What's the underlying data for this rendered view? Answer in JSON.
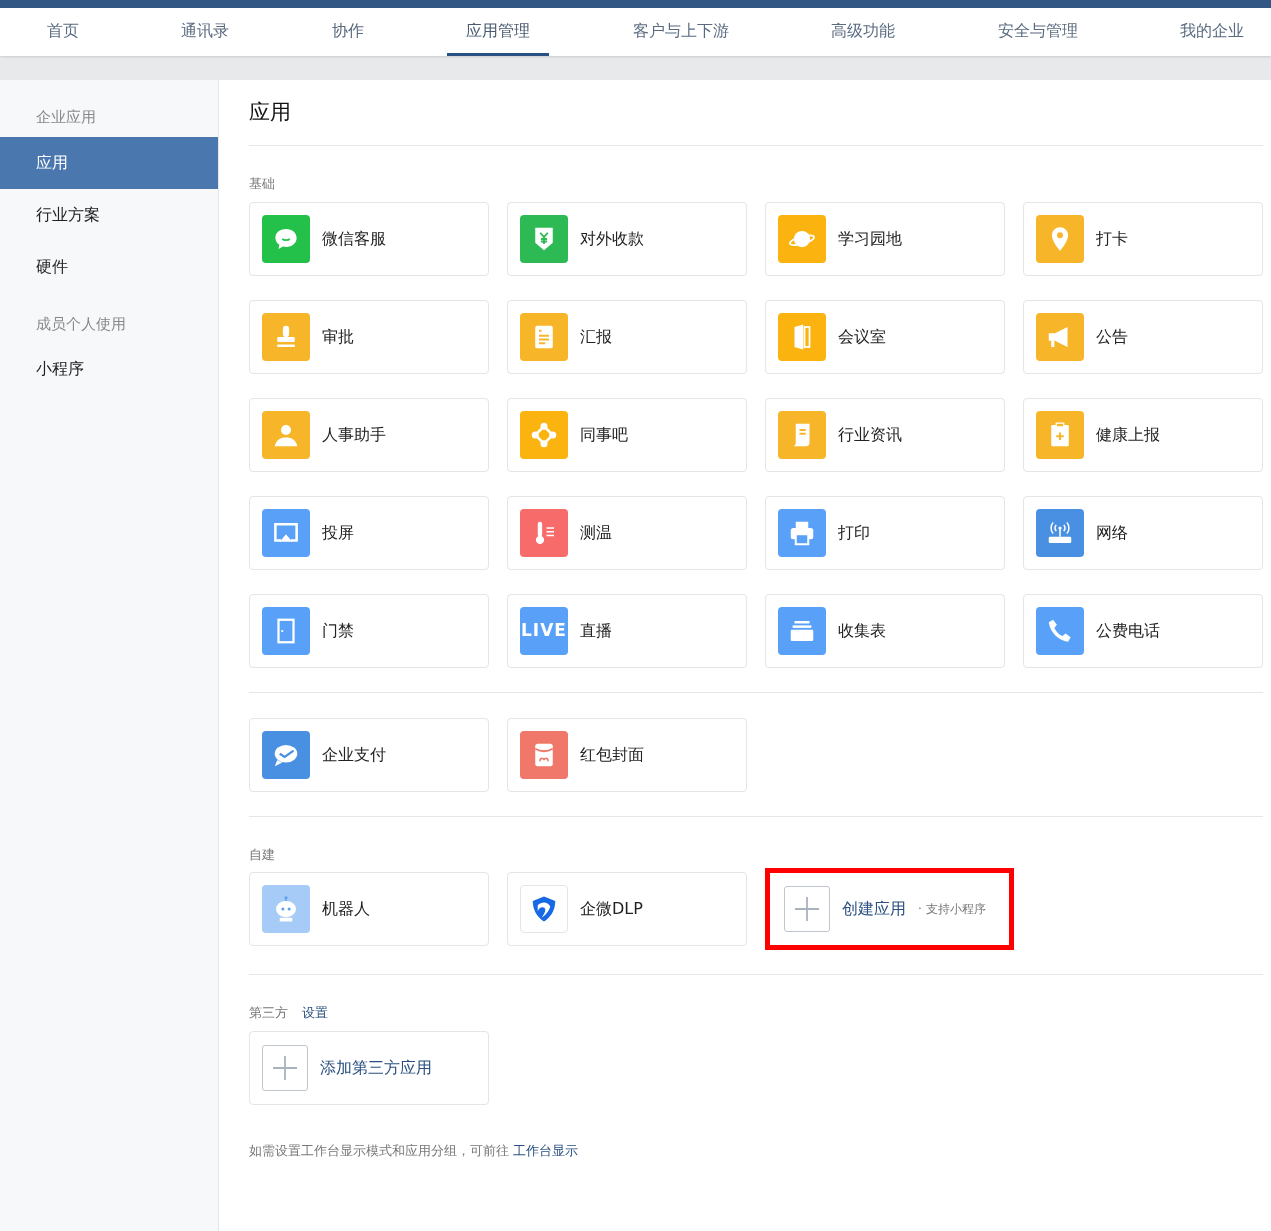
{
  "top_nav": [
    {
      "label": "首页",
      "selected": false
    },
    {
      "label": "通讯录",
      "selected": false
    },
    {
      "label": "协作",
      "selected": false
    },
    {
      "label": "应用管理",
      "selected": true
    },
    {
      "label": "客户与上下游",
      "selected": false
    },
    {
      "label": "高级功能",
      "selected": false
    },
    {
      "label": "安全与管理",
      "selected": false
    },
    {
      "label": "我的企业",
      "selected": false
    }
  ],
  "sidebar": [
    {
      "kind": "header",
      "label": "企业应用"
    },
    {
      "kind": "item",
      "label": "应用",
      "selected": true
    },
    {
      "kind": "item",
      "label": "行业方案",
      "selected": false
    },
    {
      "kind": "item",
      "label": "硬件",
      "selected": false
    },
    {
      "kind": "header",
      "label": "成员个人使用"
    },
    {
      "kind": "item",
      "label": "小程序",
      "selected": false
    }
  ],
  "page_title": "应用",
  "sections": [
    {
      "label": "基础",
      "apps": [
        {
          "name": "微信客服",
          "color": "#23c14a"
        },
        {
          "name": "对外收款",
          "color": "#2dba55"
        },
        {
          "name": "学习园地",
          "color": "#fbb40f"
        },
        {
          "name": "打卡",
          "color": "#f7b62a"
        },
        {
          "name": "审批",
          "color": "#f7b62a"
        },
        {
          "name": "汇报",
          "color": "#f7b62a"
        },
        {
          "name": "会议室",
          "color": "#fbb40f"
        },
        {
          "name": "公告",
          "color": "#f7b62a"
        },
        {
          "name": "人事助手",
          "color": "#f7b62a"
        },
        {
          "name": "同事吧",
          "color": "#fbb40f"
        },
        {
          "name": "行业资讯",
          "color": "#f7b62a"
        },
        {
          "name": "健康上报",
          "color": "#f7b62a"
        },
        {
          "name": "投屏",
          "color": "#58a0f8"
        },
        {
          "name": "测温",
          "color": "#f86b6b"
        },
        {
          "name": "打印",
          "color": "#58a0f8"
        },
        {
          "name": "网络",
          "color": "#4a90e2"
        },
        {
          "name": "门禁",
          "color": "#58a0f8"
        },
        {
          "name": "直播",
          "color": "#58a0f8",
          "icon_text": "LIVE"
        },
        {
          "name": "收集表",
          "color": "#58a0f8"
        },
        {
          "name": "公费电话",
          "color": "#58a0f8"
        }
      ]
    },
    {
      "apps": [
        {
          "name": "企业支付",
          "color": "#4a90e2"
        },
        {
          "name": "红包封面",
          "color": "#f0786a"
        }
      ]
    },
    {
      "label": "自建",
      "apps": [
        {
          "name": "机器人",
          "color": "#a6cbf7"
        },
        {
          "name": "企微DLP",
          "color": "#ffffff"
        }
      ],
      "create": {
        "label": "创建应用",
        "hint": "· 支持小程序",
        "highlighted": true
      }
    },
    {
      "label": "第三方",
      "link": "设置",
      "add": {
        "label": "添加第三方应用"
      }
    }
  ],
  "footer": {
    "text": "如需设置工作台显示模式和应用分组，可前往",
    "link": "工作台显示"
  }
}
